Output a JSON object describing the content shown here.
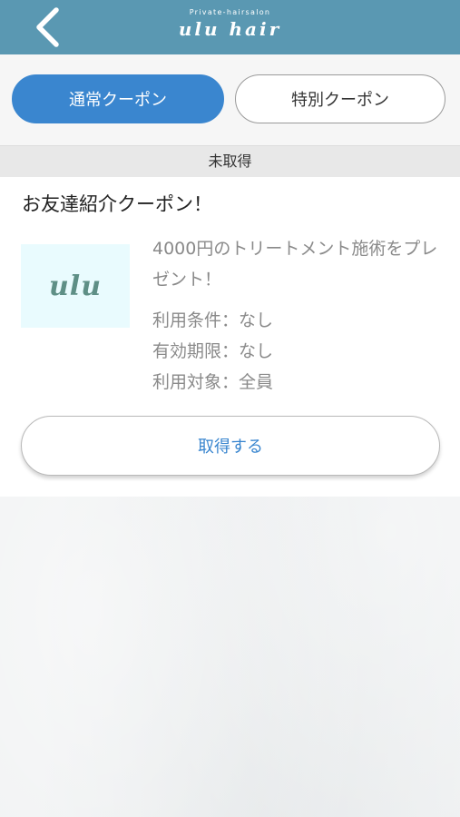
{
  "header": {
    "back_icon": "chevron-left-icon",
    "logo_small": "Private-hairsalon",
    "logo_big": "ulu hair"
  },
  "tabs": {
    "normal_label": "通常クーポン",
    "special_label": "特別クーポン",
    "active": "normal"
  },
  "status": {
    "label": "未取得"
  },
  "coupon": {
    "title": "お友達紹介クーポン！",
    "image_text": "ulu",
    "description": "4000円のトリートメント施術をプレゼント！",
    "details": [
      "利用条件：なし",
      "有効期限：なし",
      "利用対象：全員"
    ],
    "acquire_label": "取得する"
  },
  "colors": {
    "header_bg": "#5a98b2",
    "accent_blue": "#3a86cf",
    "logo_image_bg": "#e9fbfe",
    "logo_image_text": "#5e8f86"
  }
}
